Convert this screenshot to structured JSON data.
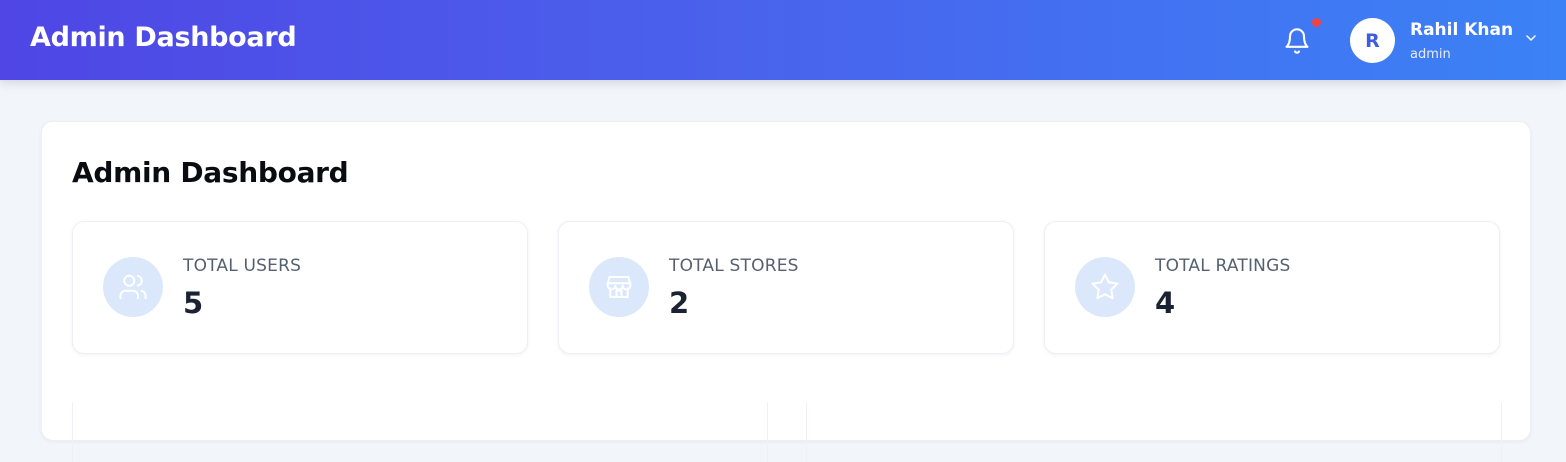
{
  "header": {
    "title": "Admin Dashboard",
    "user": {
      "initial": "R",
      "name": "Rahil Khan",
      "role": "admin"
    },
    "notification_dot_color": "#ef4444"
  },
  "main": {
    "title": "Admin Dashboard",
    "stats": [
      {
        "label": "TOTAL USERS",
        "value": "5",
        "icon": "users-icon"
      },
      {
        "label": "TOTAL STORES",
        "value": "2",
        "icon": "store-icon"
      },
      {
        "label": "TOTAL RATINGS",
        "value": "4",
        "icon": "star-icon"
      }
    ]
  },
  "colors": {
    "header_gradient_start": "#4f46e5",
    "header_gradient_end": "#3b82f6",
    "icon_bg": "#dbe8fc",
    "icon_stroke": "#ffffff"
  }
}
